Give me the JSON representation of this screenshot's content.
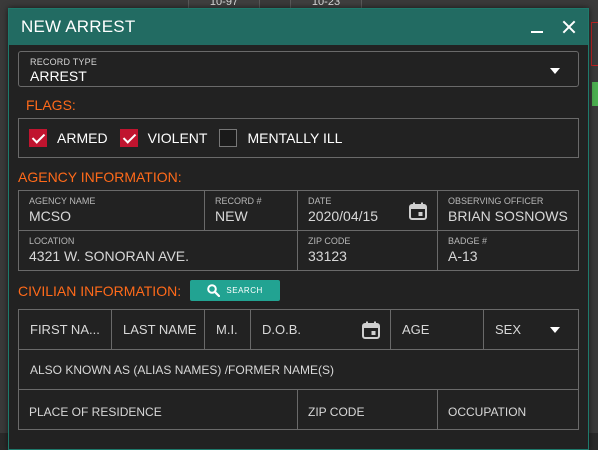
{
  "background": {
    "chip_left": "10-97",
    "chip_right": "10-23"
  },
  "modal": {
    "title": "NEW ARREST"
  },
  "record_type": {
    "label": "RECORD TYPE",
    "value": "ARREST"
  },
  "flags": {
    "title": "FLAGS:",
    "items": [
      {
        "label": "ARMED",
        "checked": true
      },
      {
        "label": "VIOLENT",
        "checked": true
      },
      {
        "label": "MENTALLY ILL",
        "checked": false
      }
    ]
  },
  "agency": {
    "title": "AGENCY INFORMATION:",
    "agency_name": {
      "label": "AGENCY NAME",
      "value": "MCSO"
    },
    "record_no": {
      "label": "RECORD #",
      "value": "NEW"
    },
    "date": {
      "label": "DATE",
      "value": "2020/04/15"
    },
    "observing_officer": {
      "label": "OBSERVING OFFICER",
      "value": "BRIAN SOSNOWS"
    },
    "location": {
      "label": "LOCATION",
      "value": "4321 W. SONORAN AVE."
    },
    "zip_code": {
      "label": "ZIP CODE",
      "value": "33123"
    },
    "badge": {
      "label": "BADGE #",
      "value": "A-13"
    }
  },
  "civilian": {
    "title": "CIVILIAN INFORMATION:",
    "search_label": "SEARCH",
    "first_name": "FIRST NA...",
    "last_name": "LAST NAME",
    "mi": "M.I.",
    "dob": "D.O.B.",
    "age": "AGE",
    "sex": "SEX",
    "alias": "ALSO KNOWN AS (ALIAS NAMES) /FORMER NAME(S)",
    "place_of_residence": "PLACE OF RESIDENCE",
    "zip_code": "ZIP CODE",
    "occupation": "OCCUPATION"
  },
  "colors": {
    "titlebar": "#226b62",
    "accent_orange": "#ff6a1a",
    "checkbox_red": "#c0142f",
    "search_teal": "#22a392"
  }
}
